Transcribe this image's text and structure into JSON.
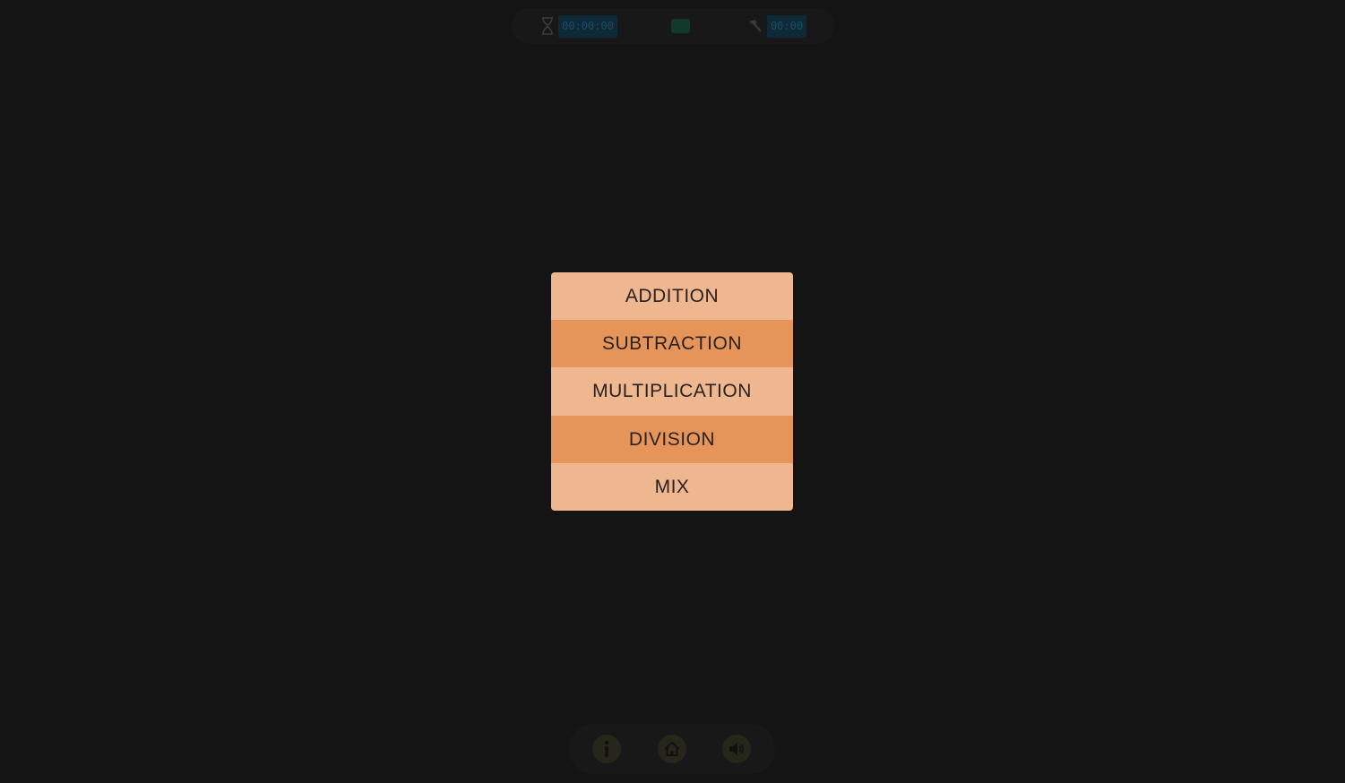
{
  "hud": {
    "timer_value": "00:00:00",
    "score_value": "00:00",
    "timer_icon": "hourglass-icon",
    "hammer_icon": "hammer-icon",
    "flag_color": "#113a2c"
  },
  "menu": {
    "items": [
      {
        "label": "ADDITION"
      },
      {
        "label": "SUBTRACTION"
      },
      {
        "label": "MULTIPLICATION"
      },
      {
        "label": "DIVISION"
      },
      {
        "label": "MIX"
      }
    ],
    "colors": {
      "light": "#eeb790",
      "dark": "#e6955a"
    }
  },
  "bottom": {
    "icons": [
      "info-icon",
      "home-icon",
      "sound-icon"
    ]
  }
}
